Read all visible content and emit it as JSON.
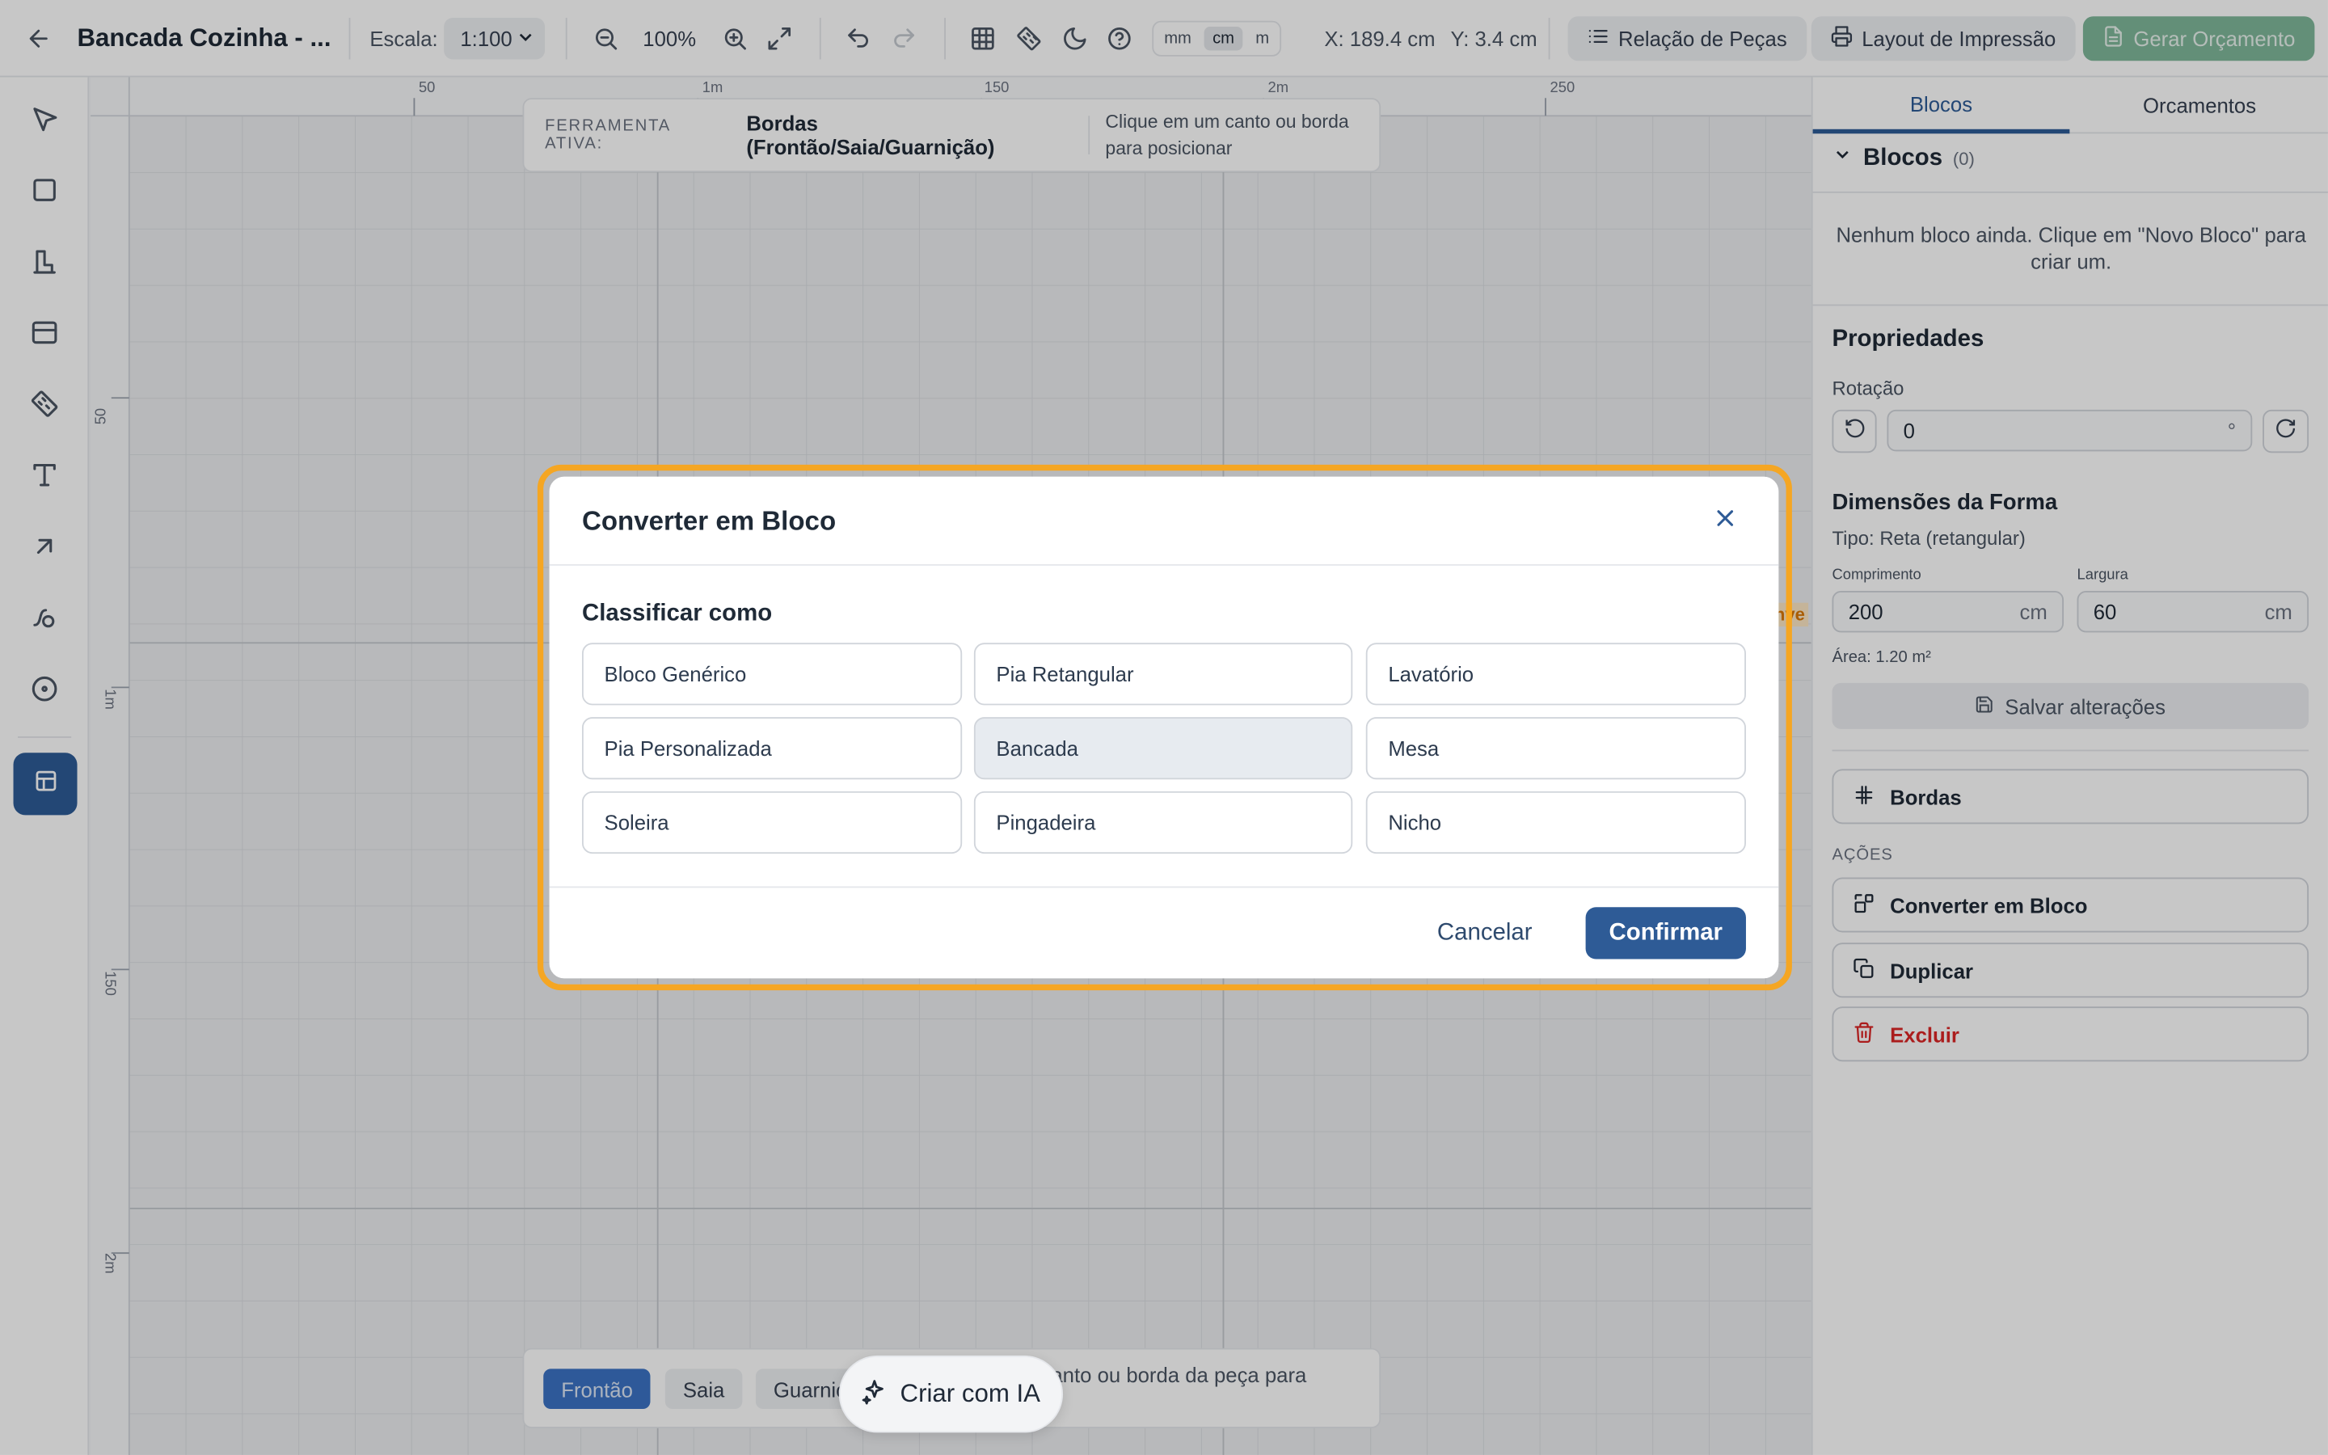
{
  "topbar": {
    "title": "Bancada Cozinha - ...",
    "scale_label": "Escala:",
    "scale_value": "1:100",
    "zoom": "100%",
    "units": [
      "mm",
      "cm",
      "m"
    ],
    "active_unit": "cm",
    "coord_x": "X: 189.4 cm",
    "coord_y": "Y: 3.4 cm",
    "parts_list": "Relação de Peças",
    "print_layout": "Layout de Impressão",
    "generate_quote": "Gerar Orçamento"
  },
  "rulers": {
    "top": [
      "50",
      "1m",
      "150",
      "2m",
      "250"
    ],
    "left": [
      "50",
      "1m",
      "150",
      "2m"
    ]
  },
  "tool_banner": {
    "label": "FERRAMENTA ATIVA:",
    "tool": "Bordas (Frontão/Saia/Guarnição)",
    "hint": "Clique em um canto ou borda para posicionar"
  },
  "bottom_bar": {
    "tabs": [
      "Frontão",
      "Saia",
      "Guarnição"
    ],
    "hint": "anto ou borda da peça para",
    "ai_button": "Criar com IA"
  },
  "canvas_fragment": "nve",
  "right_panel": {
    "tabs": [
      "Blocos",
      "Orcamentos"
    ],
    "blocks_title": "Blocos",
    "blocks_count": "(0)",
    "empty_message": "Nenhum bloco ainda. Clique em \"Novo Bloco\" para criar um.",
    "properties_title": "Propriedades",
    "rotation_label": "Rotação",
    "rotation_value": "0",
    "rotation_unit": "°",
    "dims_title": "Dimensões da Forma",
    "type_text": "Tipo: Reta (retangular)",
    "length_label": "Comprimento",
    "length_value": "200",
    "length_unit": "cm",
    "width_label": "Largura",
    "width_value": "60",
    "width_unit": "cm",
    "area_text": "Área: 1.20 m²",
    "save_button": "Salvar alterações",
    "borders_button": "Bordas",
    "actions_label": "AÇÕES",
    "convert_button": "Converter em Bloco",
    "duplicate_button": "Duplicar",
    "delete_button": "Excluir"
  },
  "modal": {
    "title": "Converter em Bloco",
    "section_label": "Classificar como",
    "options": [
      "Bloco Genérico",
      "Pia Retangular",
      "Lavatório",
      "Pia Personalizada",
      "Bancada",
      "Mesa",
      "Soleira",
      "Pingadeira",
      "Nicho"
    ],
    "selected": "Bancada",
    "cancel": "Cancelar",
    "confirm": "Confirmar"
  },
  "colors": {
    "primary": "#2e5b96",
    "accent_highlight": "#f5a623",
    "danger": "#dc2626",
    "generate_button": "#7fb89a"
  }
}
